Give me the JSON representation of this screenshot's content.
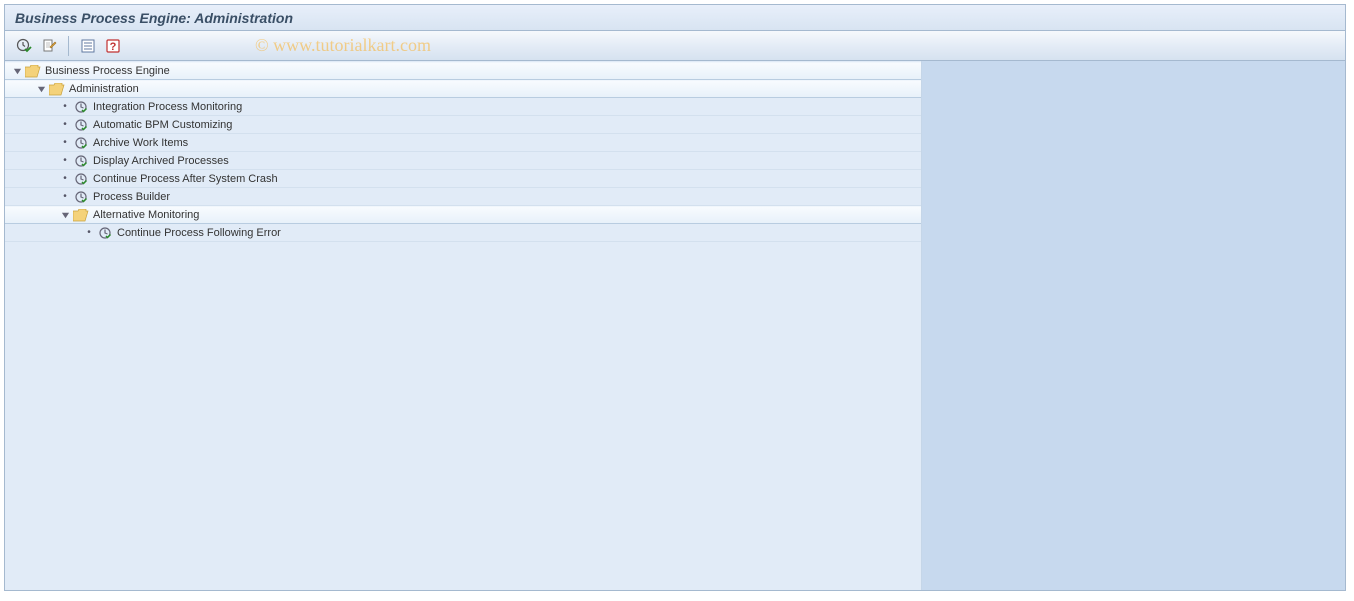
{
  "title": "Business Process Engine: Administration",
  "watermark": "© www.tutorialkart.com",
  "toolbar_icons": {
    "execute": "clock-checkmark-icon",
    "document": "document-edit-icon",
    "list": "list-icon",
    "help": "help-icon"
  },
  "tree": {
    "root": {
      "label": "Business Process Engine",
      "expanded": true,
      "children": {
        "admin": {
          "label": "Administration",
          "expanded": true,
          "items": [
            "Integration Process Monitoring",
            "Automatic BPM Customizing",
            "Archive Work Items",
            "Display Archived Processes",
            "Continue Process After System Crash",
            "Process Builder"
          ],
          "subfolder": {
            "label": "Alternative Monitoring",
            "expanded": true,
            "items": [
              "Continue Process Following Error"
            ]
          }
        }
      }
    }
  }
}
